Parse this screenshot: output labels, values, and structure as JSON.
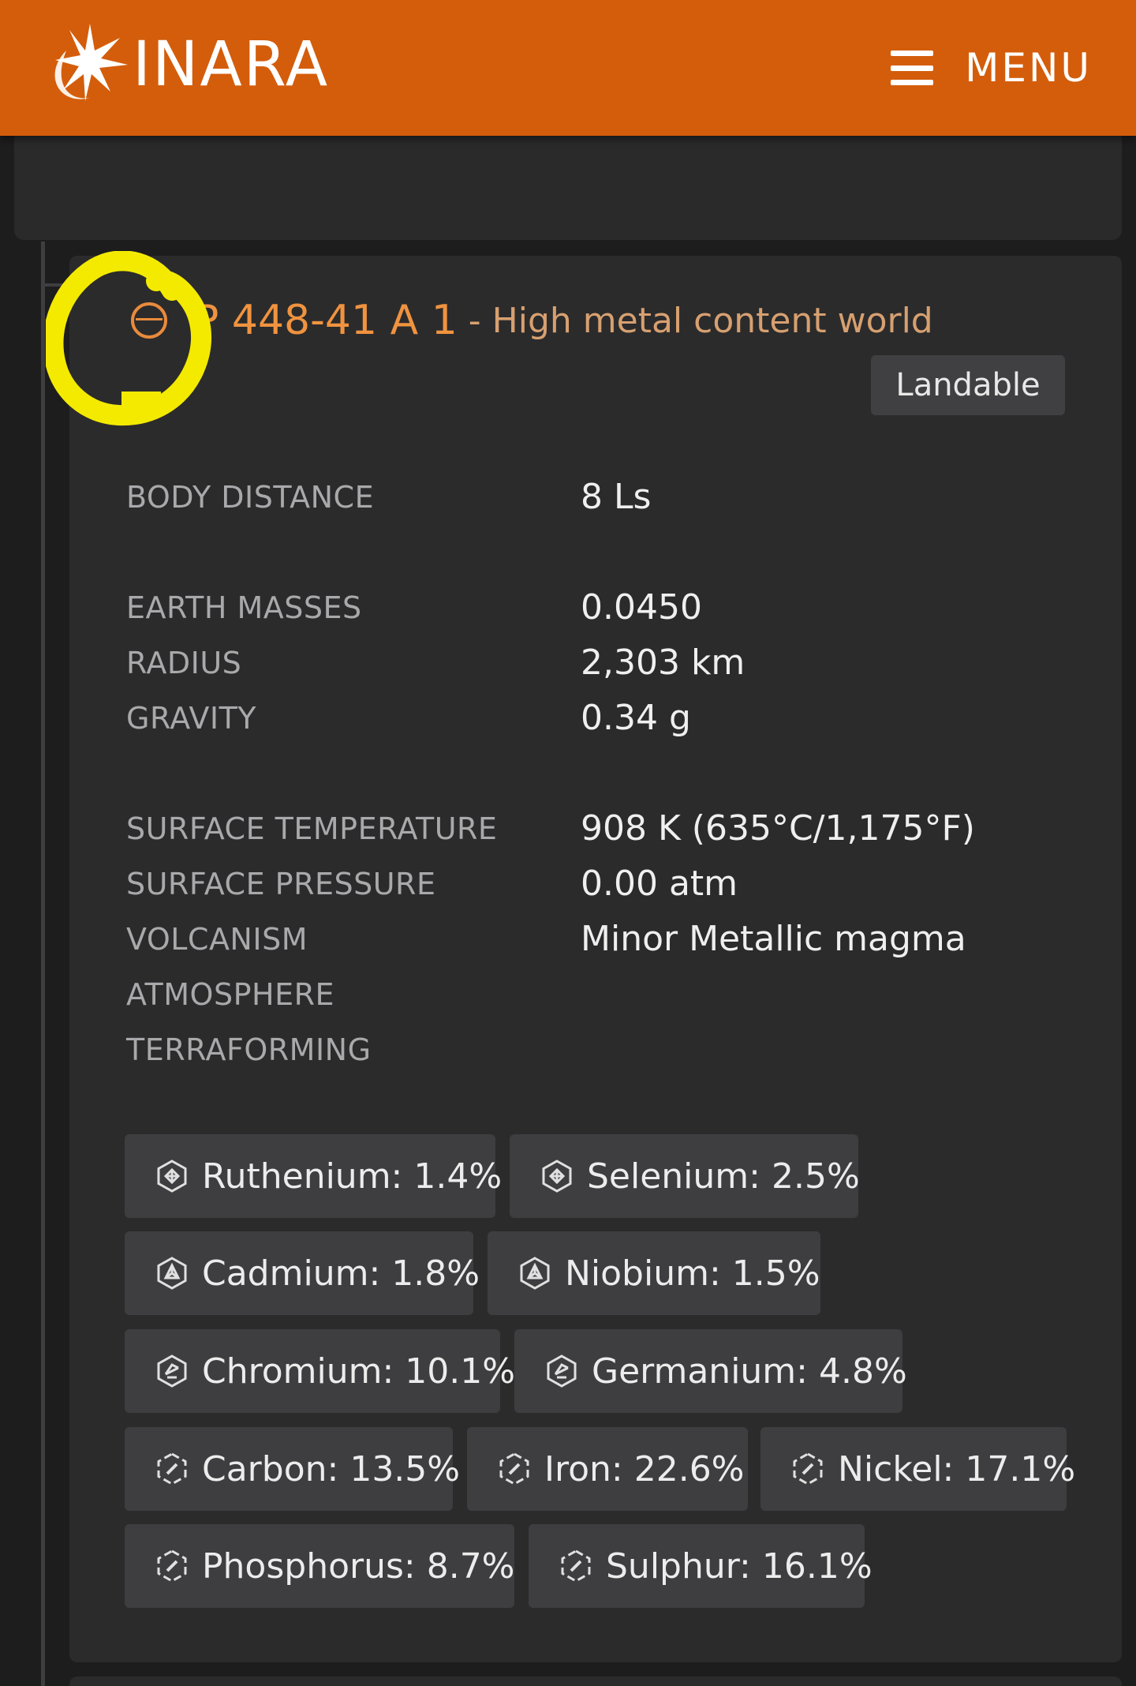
{
  "header": {
    "logo_text": "INARA",
    "menu_label": "MENU",
    "bg_color": "#d45d0b"
  },
  "body": {
    "name": "HIP 448-41 A 1",
    "name_visible": "P 448-41 A 1",
    "type": "- High metal content world",
    "badge": "Landable",
    "icon": "planet-icon"
  },
  "properties": {
    "body_distance": {
      "label": "BODY DISTANCE",
      "value": "8 Ls"
    },
    "earth_masses": {
      "label": "EARTH MASSES",
      "value": "0.0450"
    },
    "radius": {
      "label": "RADIUS",
      "value": "2,303 km"
    },
    "gravity": {
      "label": "GRAVITY",
      "value": "0.34 g"
    },
    "surface_temperature": {
      "label": "SURFACE TEMPERATURE",
      "value": "908 K (635°C/1,175°F)"
    },
    "surface_pressure": {
      "label": "SURFACE PRESSURE",
      "value": "0.00 atm"
    },
    "volcanism": {
      "label": "VOLCANISM",
      "value": "Minor Metallic magma"
    },
    "atmosphere": {
      "label": "ATMOSPHERE",
      "value": ""
    },
    "terraforming": {
      "label": "TERRAFORMING",
      "value": ""
    }
  },
  "materials": [
    {
      "text": "Ruthenium: 1.4%",
      "icon": "grade-4-material-icon"
    },
    {
      "text": "Selenium: 2.5%",
      "icon": "grade-4-material-icon"
    },
    {
      "text": "Cadmium: 1.8%",
      "icon": "grade-3-material-icon"
    },
    {
      "text": "Niobium: 1.5%",
      "icon": "grade-3-material-icon"
    },
    {
      "text": "Chromium: 10.1%",
      "icon": "grade-2-material-icon"
    },
    {
      "text": "Germanium: 4.8%",
      "icon": "grade-2-material-icon"
    },
    {
      "text": "Carbon: 13.5%",
      "icon": "grade-1-material-icon"
    },
    {
      "text": "Iron: 22.6%",
      "icon": "grade-1-material-icon"
    },
    {
      "text": "Nickel: 17.1%",
      "icon": "grade-1-material-icon"
    },
    {
      "text": "Phosphorus: 8.7%",
      "icon": "grade-1-material-icon"
    },
    {
      "text": "Sulphur: 16.1%",
      "icon": "grade-1-material-icon"
    }
  ],
  "annotation": {
    "color": "#f4ea00",
    "shape": "hand-drawn-circle"
  }
}
